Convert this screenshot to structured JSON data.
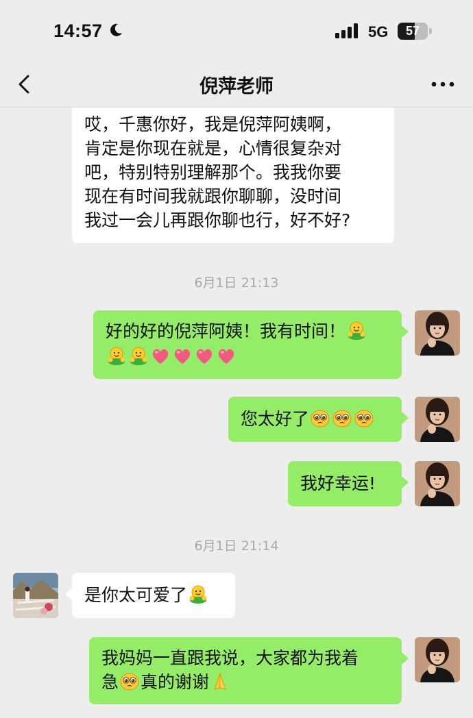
{
  "status_bar": {
    "time": "14:57",
    "network": "5G",
    "battery_level": "57",
    "battery_fraction": 0.57,
    "moon_icon": "moon-icon",
    "signal_icon": "signal-bars-icon"
  },
  "header": {
    "title": "倪萍老师",
    "back_icon": "chevron-left-icon",
    "more_icon": "more-dots-icon"
  },
  "messages": {
    "m1": {
      "line1": "哎，千惠你好，我是倪萍阿姨啊，",
      "line2": "肯定是你现在就是，心情很复杂对",
      "line3": "吧，特别特别理解那个。我我你要",
      "line4": "现在有时间我就跟你聊聊，没时间",
      "line5": "我过一会儿再跟你聊也行，好不好?"
    },
    "ts1": "6月1日 21:13",
    "m2": {
      "text1": "好的好的倪萍阿姨！我有时间！",
      "emoji_1": "smile-hug-emoji",
      "emoji_2": "heart-emoji"
    },
    "m3": {
      "text": "您太好了",
      "emoji": "pleading-face-emoji"
    },
    "m4": {
      "text": "我好幸运!"
    },
    "ts2": "6月1日 21:14",
    "m5": {
      "text": "是你太可爱了",
      "emoji": "smile-hug-emoji"
    },
    "m6": {
      "line1": "我妈妈一直跟我说，大家都为我着",
      "line2a": "急",
      "line2b": "真的谢谢",
      "emoji_1": "pleading-face-emoji",
      "emoji_2": "folded-hands-emoji"
    }
  },
  "colors": {
    "background": "#ededed",
    "incoming_bubble": "#ffffff",
    "outgoing_bubble": "#95ec69",
    "timestamp": "#a8a8a8"
  }
}
